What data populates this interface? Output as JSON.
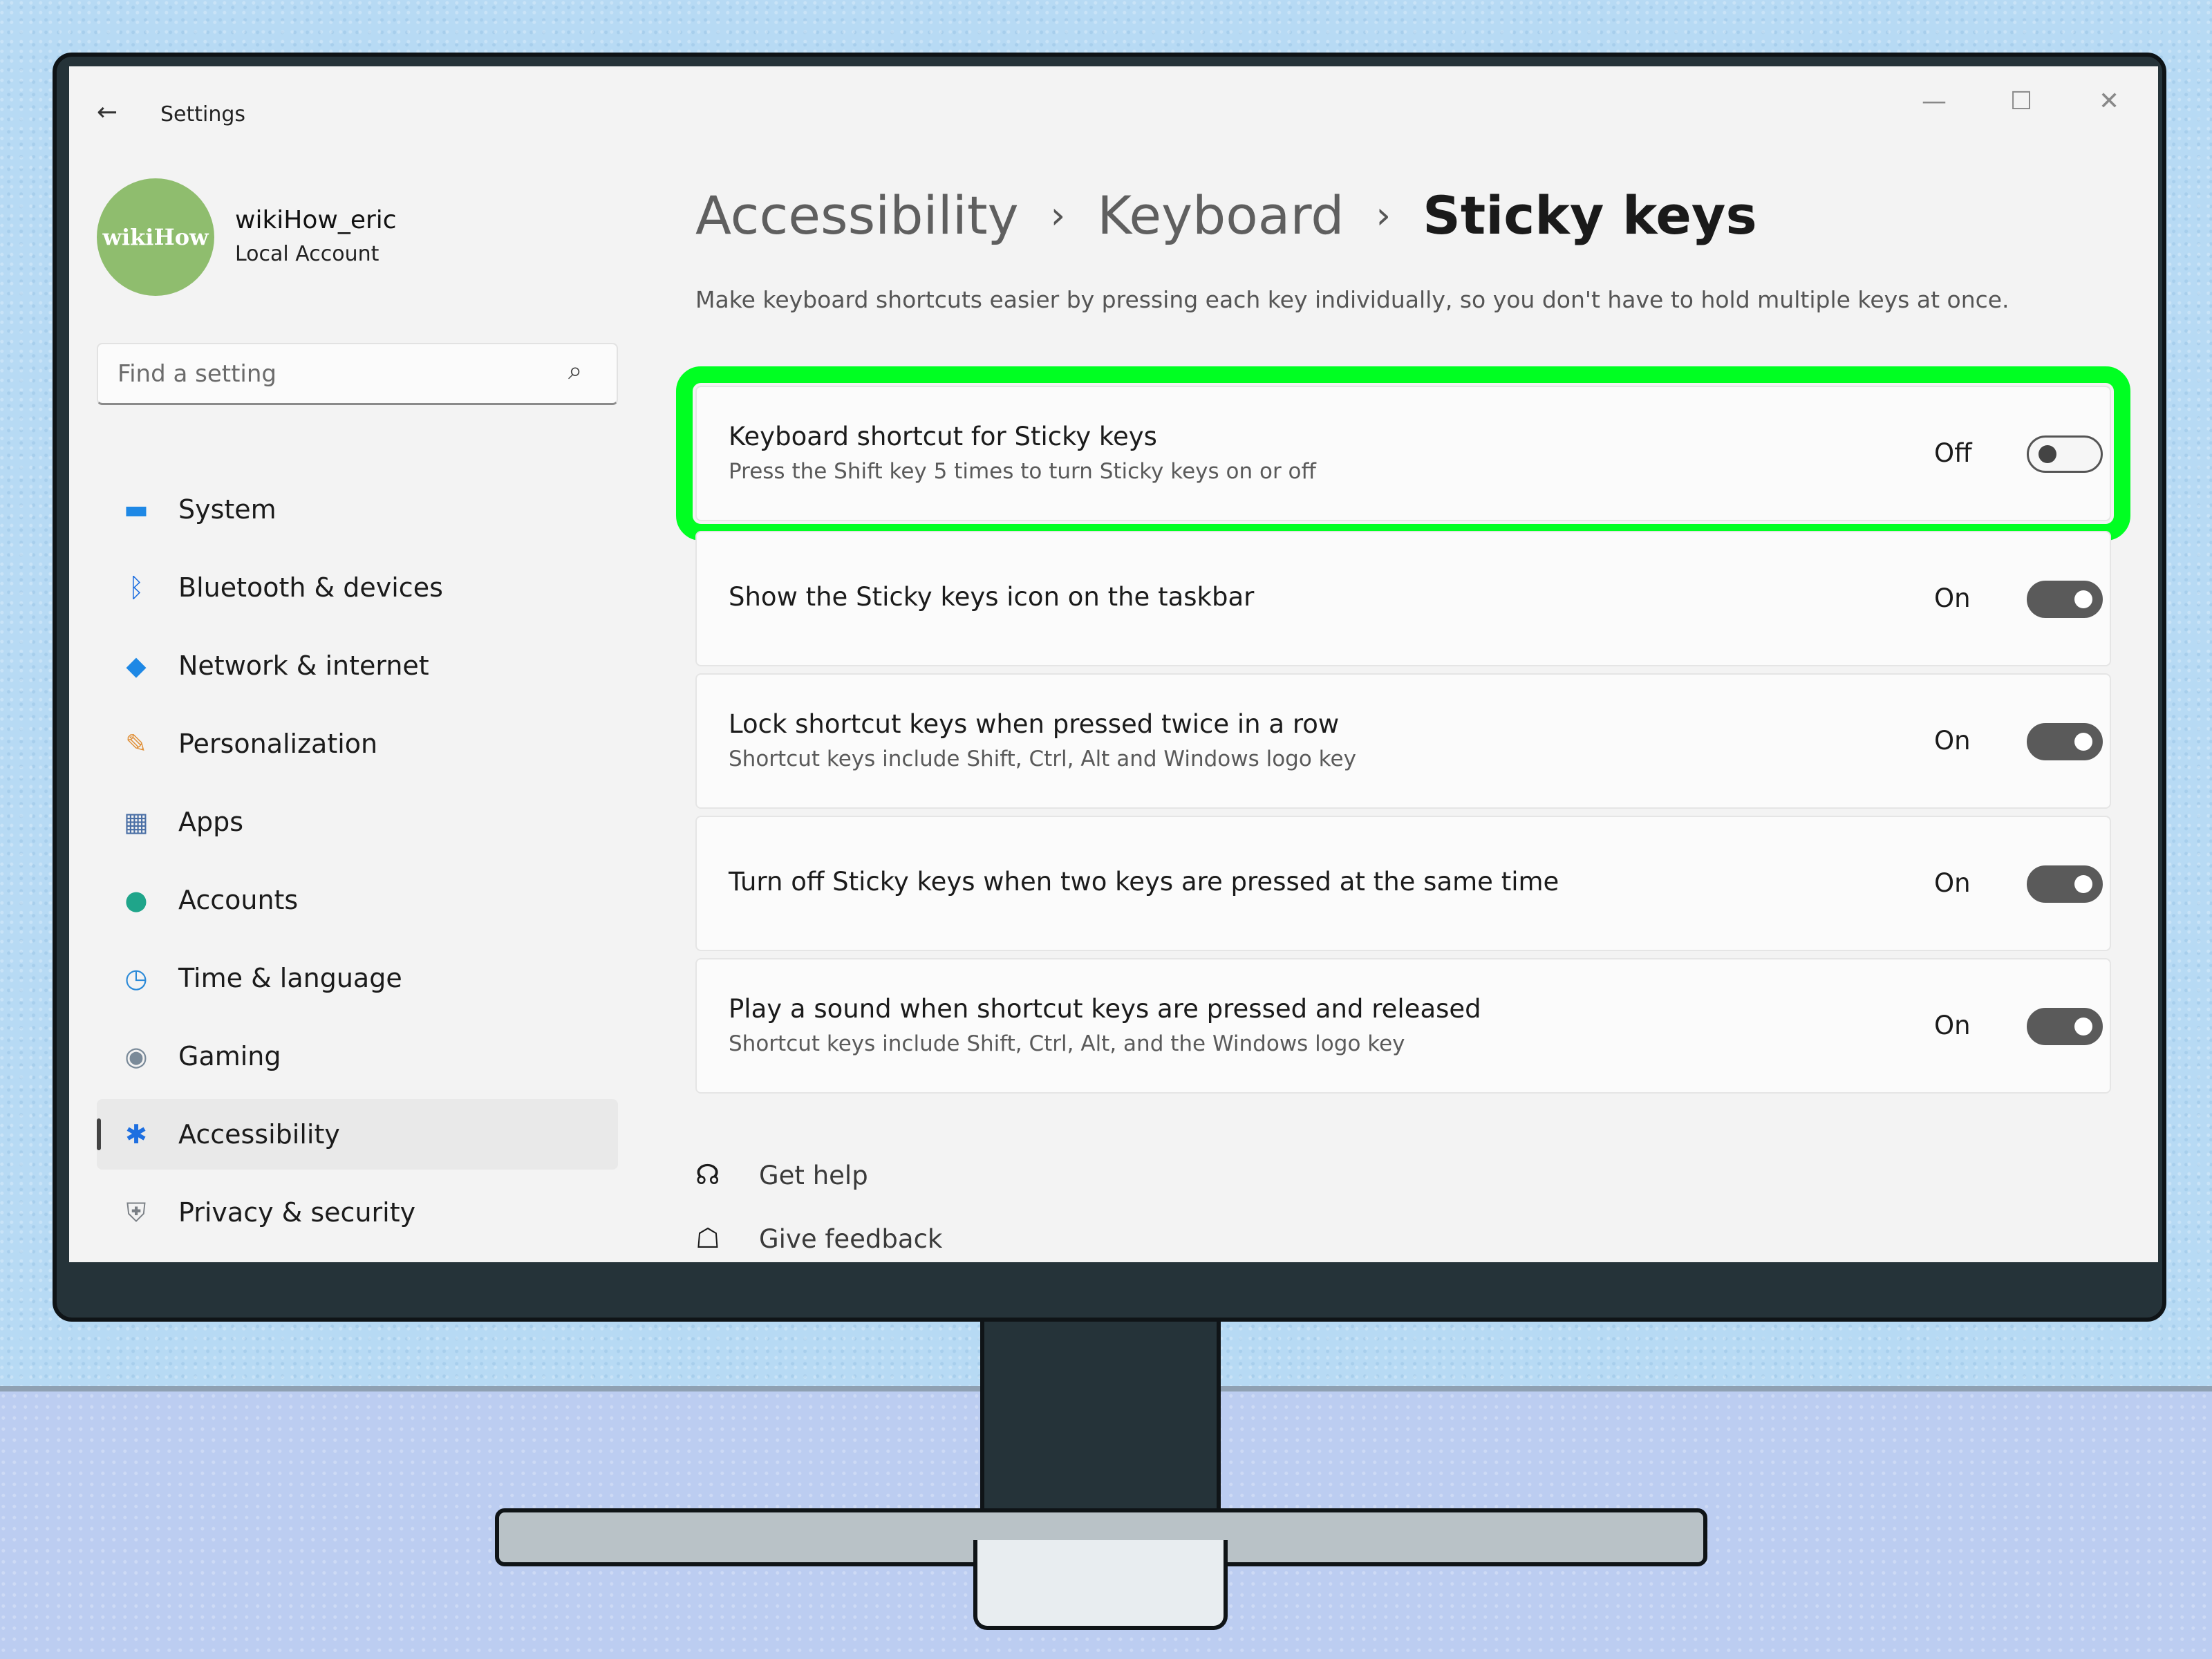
{
  "window": {
    "app_title": "Settings",
    "back_icon": "←",
    "min_icon": "—",
    "max_icon": "☐",
    "close_icon": "✕"
  },
  "user": {
    "avatar_text": "wikiHow",
    "name": "wikiHow_eric",
    "account_type": "Local Account"
  },
  "search": {
    "placeholder": "Find a setting",
    "icon": "⌕"
  },
  "sidebar": {
    "items": [
      {
        "label": "System",
        "icon": "▬",
        "icon_color": "#1e88e5",
        "active": false
      },
      {
        "label": "Bluetooth & devices",
        "icon": "ᛒ",
        "icon_color": "#1e6fe0",
        "active": false
      },
      {
        "label": "Network & internet",
        "icon": "◆",
        "icon_color": "#1e88e5",
        "active": false
      },
      {
        "label": "Personalization",
        "icon": "✎",
        "icon_color": "#e0913a",
        "active": false
      },
      {
        "label": "Apps",
        "icon": "▦",
        "icon_color": "#4a6fa5",
        "active": false
      },
      {
        "label": "Accounts",
        "icon": "●",
        "icon_color": "#1fa58a",
        "active": false
      },
      {
        "label": "Time & language",
        "icon": "◷",
        "icon_color": "#2b8ad8",
        "active": false
      },
      {
        "label": "Gaming",
        "icon": "◉",
        "icon_color": "#7a8a99",
        "active": false
      },
      {
        "label": "Accessibility",
        "icon": "✱",
        "icon_color": "#1e6fe0",
        "active": true
      },
      {
        "label": "Privacy & security",
        "icon": "⛨",
        "icon_color": "#7a7f85",
        "active": false
      }
    ]
  },
  "breadcrumb": {
    "items": [
      "Accessibility",
      "Keyboard"
    ],
    "separator": "›",
    "current": "Sticky keys"
  },
  "description": "Make keyboard shortcuts easier by pressing each key individually, so you don't have to hold multiple keys at once.",
  "settings": [
    {
      "title": "Keyboard shortcut for Sticky keys",
      "subtitle": "Press the Shift key 5 times to turn Sticky keys on or off",
      "state": "Off",
      "on": false,
      "highlighted": true
    },
    {
      "title": "Show the Sticky keys icon on the taskbar",
      "subtitle": "",
      "state": "On",
      "on": true,
      "highlighted": false
    },
    {
      "title": "Lock shortcut keys when pressed twice in a row",
      "subtitle": "Shortcut keys include Shift, Ctrl, Alt and Windows logo key",
      "state": "On",
      "on": true,
      "highlighted": false
    },
    {
      "title": "Turn off Sticky keys when two keys are pressed at the same time",
      "subtitle": "",
      "state": "On",
      "on": true,
      "highlighted": false
    },
    {
      "title": "Play a sound when shortcut keys are pressed and released",
      "subtitle": "Shortcut keys include Shift, Ctrl, Alt, and the Windows logo key",
      "state": "On",
      "on": true,
      "highlighted": false
    }
  ],
  "help": {
    "get_help": "Get help",
    "give_feedback": "Give feedback",
    "get_help_icon": "☊",
    "give_feedback_icon": "☖"
  },
  "colors": {
    "highlight": "#00ff22",
    "toggle_on": "#5a5a5a"
  }
}
